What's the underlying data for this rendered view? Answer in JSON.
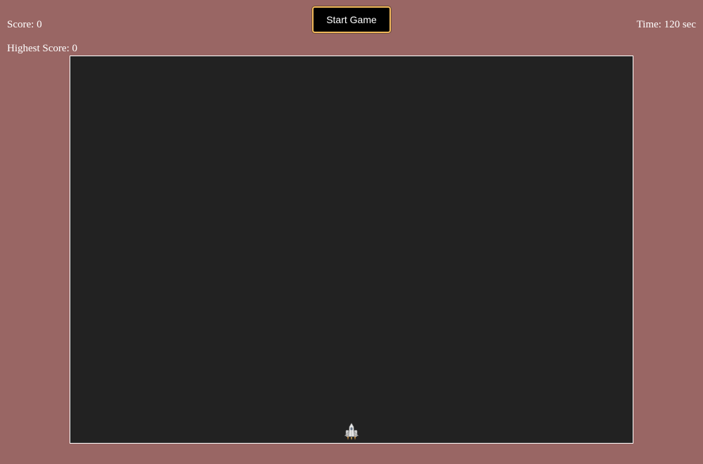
{
  "hud": {
    "score_label": "Score: 0",
    "highest_score_label": "Highest Score: 0",
    "time_label": "Time: 120 sec"
  },
  "controls": {
    "start_button_label": "Start Game"
  },
  "game": {
    "player_icon": "spaceship-icon"
  },
  "colors": {
    "page_background": "#996664",
    "game_background": "#222222",
    "button_background": "#000000",
    "button_border": "#f0b85a"
  }
}
